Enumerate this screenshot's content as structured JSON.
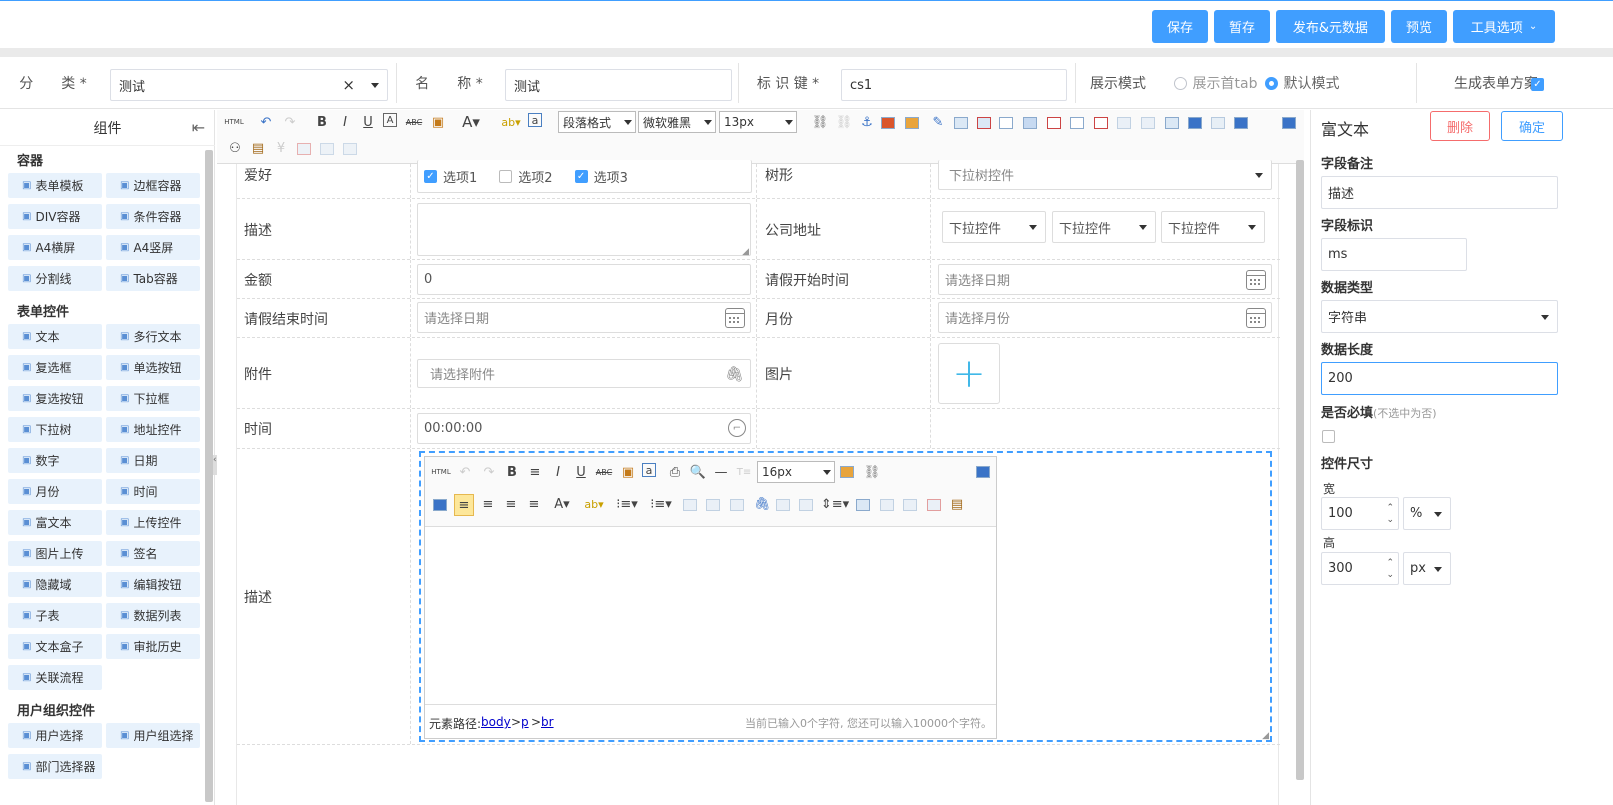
{
  "toolbar_buttons": {
    "save": "保存",
    "draft": "暂存",
    "publish": "发布&元数据",
    "preview": "预览",
    "tools": "工具选项"
  },
  "meta": {
    "category_label": "分　　类 *",
    "category_value": "测试",
    "name_label": "名　　称 *",
    "name_value": "测试",
    "key_label": "标 识 键 *",
    "key_value": "cs1",
    "display_label": "展示模式",
    "display_opt1": "展示首tab",
    "display_opt2": "默认模式",
    "gen_label": "生成表单方案"
  },
  "left": {
    "header": "组件",
    "groups": {
      "container": {
        "title": "容器",
        "items": [
          "表单模板",
          "边框容器",
          "DIV容器",
          "条件容器",
          "A4横屏",
          "A4竖屏",
          "分割线",
          "Tab容器"
        ]
      },
      "form": {
        "title": "表单控件",
        "items": [
          "文本",
          "多行文本",
          "复选框",
          "单选按钮",
          "复选按钮",
          "下拉框",
          "下拉树",
          "地址控件",
          "数字",
          "日期",
          "月份",
          "时间",
          "富文本",
          "上传控件",
          "图片上传",
          "签名",
          "隐藏域",
          "编辑按钮",
          "子表",
          "数据列表",
          "文本盒子",
          "审批历史",
          "关联流程"
        ]
      },
      "org": {
        "title": "用户组织控件",
        "items": [
          "用户选择",
          "用户组选择",
          "部门选择器"
        ]
      }
    }
  },
  "editor_toolbar": {
    "para_format": "段落格式",
    "font_family": "微软雅黑",
    "font_size": "13px"
  },
  "form": {
    "hobby_label": "爱好",
    "hobby_opts": [
      "选项1",
      "选项2",
      "选项3"
    ],
    "tree_label": "树形",
    "tree_placeholder": "下拉树控件",
    "desc_label": "描述",
    "address_label": "公司地址",
    "address_selects": [
      "下拉控件",
      "下拉控件",
      "下拉控件"
    ],
    "amount_label": "金额",
    "amount_value": "0",
    "leave_start_label": "请假开始时间",
    "date_placeholder": "请选择日期",
    "leave_end_label": "请假结束时间",
    "month_label": "月份",
    "month_placeholder": "请选择月份",
    "attach_label": "附件",
    "attach_placeholder": "请选择附件",
    "image_label": "图片",
    "time_label": "时间",
    "time_value": "00:00:00",
    "rich_label": "描述"
  },
  "rte": {
    "font_size": "16px",
    "path_label": "元素路径:",
    "path_body": "body",
    "path_p": "p",
    "path_br": "br",
    "count_text": "当前已输入0个字符, 您还可以输入10000个字符。"
  },
  "right": {
    "title": "富文本",
    "delete": "删除",
    "confirm": "确定",
    "remark_label": "字段备注",
    "remark_value": "描述",
    "key_label": "字段标识",
    "key_value": "ms",
    "type_label": "数据类型",
    "type_value": "字符串",
    "length_label": "数据长度",
    "length_value": "200",
    "required_label": "是否必填",
    "required_hint": "(不选中为否)",
    "size_label": "控件尺寸",
    "width_label": "宽",
    "width_value": "100",
    "width_unit": "%",
    "height_label": "高",
    "height_value": "300",
    "height_unit": "px"
  },
  "colors": {
    "accent": "#409eff",
    "comp_bg": "#e8f2fc",
    "danger": "#f56c6c"
  }
}
